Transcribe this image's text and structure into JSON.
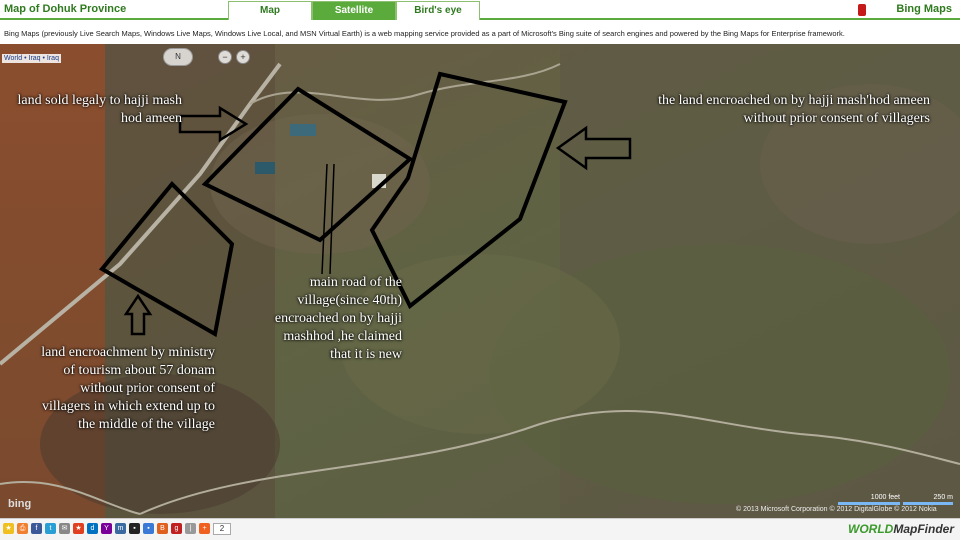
{
  "header": {
    "title": "Map of Dohuk Province",
    "brand": "Bing Maps",
    "tabs": [
      {
        "label": "Map",
        "active": false
      },
      {
        "label": "Satellite",
        "active": true
      },
      {
        "label": "Bird's eye",
        "active": false
      }
    ]
  },
  "description": "Bing Maps (previously Live Search Maps, Windows Live Maps, Windows Live Local, and MSN Virtual Earth) is a web mapping service provided as a part of Microsoft's Bing suite of search engines and powered by the Bing Maps for Enterprise framework.",
  "map": {
    "breadcrumb": "World • Iraq • Iraq",
    "compass": "N",
    "zoom_out": "−",
    "zoom_in": "+",
    "annotations": {
      "a1": "land sold legaly to hajji mash hod ameen",
      "a2": "the land encroached on by hajji mash'hod ameen without prior consent of villagers",
      "a3": "main road of the village(since 40th) encroached on by hajji mashhod ,he claimed that it is new",
      "a4": "land encroachment by ministry of tourism about 57 donam without prior consent of villagers in which extend up to the middle of the village"
    },
    "logo": "bing",
    "copyright": "© 2013 Microsoft Corporation   © 2012 DigitalGlobe   © 2012 Nokia",
    "scale_feet": "1000 feet",
    "scale_m": "250 m"
  },
  "footer": {
    "share_count": "2",
    "site_logo_a": "WORLD",
    "site_logo_b": "MapFinder"
  },
  "colors": {
    "accent": "#5aaa3c",
    "brand_text": "#2f7a1f"
  }
}
